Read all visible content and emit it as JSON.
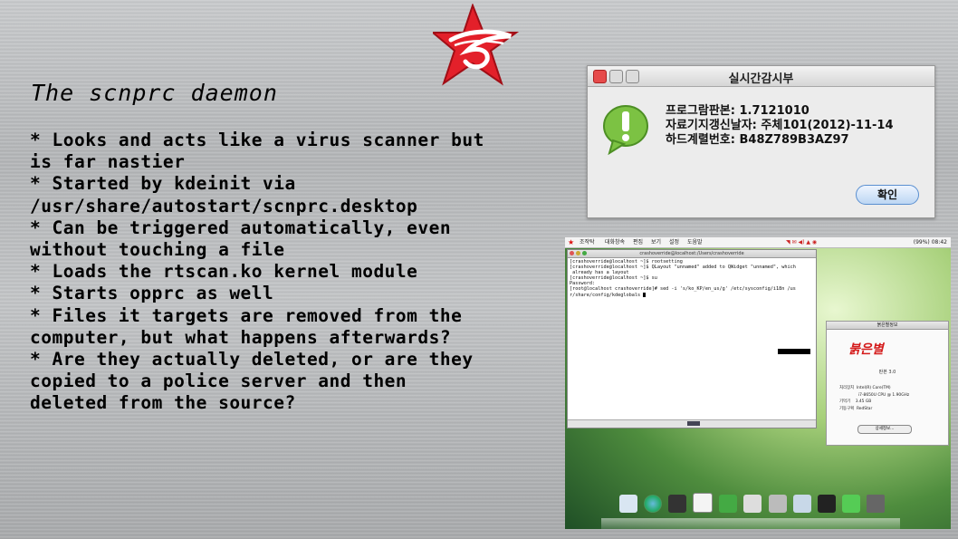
{
  "slide": {
    "title": "The scnprc daemon",
    "bullets": [
      "* Looks and acts like a virus scanner but",
      "is far nastier",
      "* Started by kdeinit via",
      "/usr/share/autostart/scnprc.desktop",
      "* Can be triggered automatically, even",
      "without touching a file",
      "* Loads the rtscan.ko kernel module",
      "* Starts opprc as well",
      "* Files it targets are removed from the",
      "computer, but what happens afterwards?",
      "* Are they actually deleted, or are they",
      "copied to a police server and then",
      "deleted from the source?"
    ],
    "logo_icon": "red-star-logo-icon",
    "colors": {
      "accent": "#e3202a"
    }
  },
  "dialog": {
    "title": "실시간감시부",
    "icon": "exclamation-icon",
    "lines": [
      "프로그람판본: 1.7121010",
      "자료기지갱신날자: 주체101(2012)-11-14",
      "하드계렬번호: B48Z789B3AZ97"
    ],
    "ok_label": "확인"
  },
  "desktop": {
    "menu": [
      "조작탁",
      "대화창속",
      "편집",
      "보기",
      "설정",
      "도움말"
    ],
    "clock": "08:42",
    "battery": "(99%)",
    "terminal": {
      "title": "crashoverride@localhost:/Users/crashoverride",
      "lines": [
        "[crashoverride@localhost ~]$ rootsetting",
        "[crashoverride@localhost ~]$ QLayout \"unnamed\" added to QWidget \"unnamed\", which",
        " already has a layout",
        "",
        "[crashoverride@localhost ~]$ su",
        "Password:",
        "[root@localhost crashoverride]# sed -i 's/ko_KP/en_us/g' /etc/sysconfig/i18n /us",
        "r/share/config/kdeglobals "
      ]
    },
    "sysinfo": {
      "title": "붉은별정보",
      "logo": "붉은별",
      "version": "판본 3.0",
      "specs": [
        "처리장치  Intel(R) Core(TM)",
        "               i7-8650U CPU @ 1.90GHz",
        "기억기    3.45 GB",
        "기동구획  RedStar"
      ],
      "button": "상세정보..."
    }
  }
}
